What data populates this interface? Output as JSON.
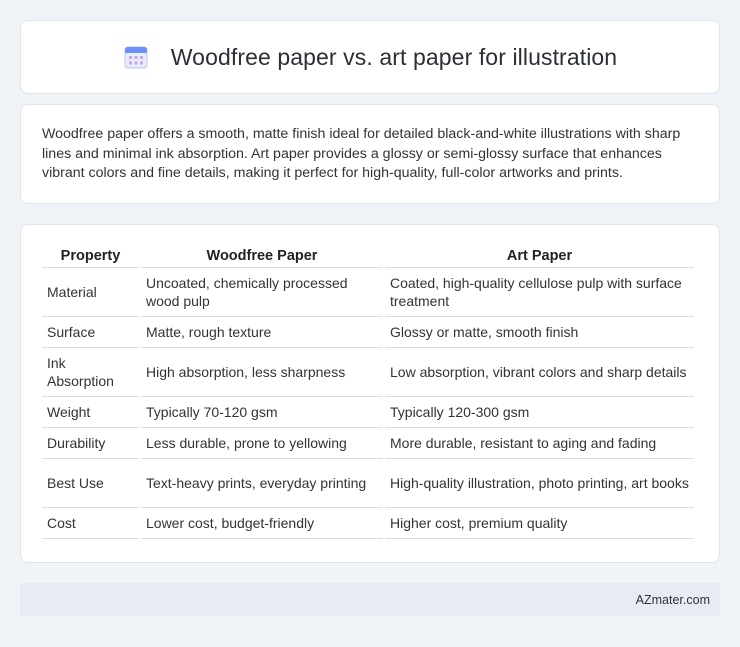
{
  "header": {
    "title": "Woodfree paper vs. art paper for illustration",
    "icon": "calendar-icon",
    "icon_colors": {
      "top": "#6e8ff5",
      "body": "#e9ecfb",
      "dots": "#c3a5e8"
    }
  },
  "intro": {
    "text": "Woodfree paper offers a smooth, matte finish ideal for detailed black-and-white illustrations with sharp lines and minimal ink absorption. Art paper provides a glossy or semi-glossy surface that enhances vibrant colors and fine details, making it perfect for high-quality, full-color artworks and prints."
  },
  "table": {
    "headers": [
      "Property",
      "Woodfree Paper",
      "Art Paper"
    ],
    "rows": [
      {
        "property": "Material",
        "woodfree": "Uncoated, chemically processed wood pulp",
        "art": "Coated, high-quality cellulose pulp with surface treatment"
      },
      {
        "property": "Surface",
        "woodfree": "Matte, rough texture",
        "art": "Glossy or matte, smooth finish"
      },
      {
        "property": "Ink Absorption",
        "woodfree": "High absorption, less sharpness",
        "art": "Low absorption, vibrant colors and sharp details"
      },
      {
        "property": "Weight",
        "woodfree": "Typically 70-120 gsm",
        "art": "Typically 120-300 gsm"
      },
      {
        "property": "Durability",
        "woodfree": "Less durable, prone to yellowing",
        "art": "More durable, resistant to aging and fading"
      },
      {
        "property": "Best Use",
        "woodfree": "Text-heavy prints, everyday printing",
        "art": "High-quality illustration, photo printing, art books"
      },
      {
        "property": "Cost",
        "woodfree": "Lower cost, budget-friendly",
        "art": "Higher cost, premium quality"
      }
    ]
  },
  "footer": {
    "text": "AZmater.com"
  }
}
